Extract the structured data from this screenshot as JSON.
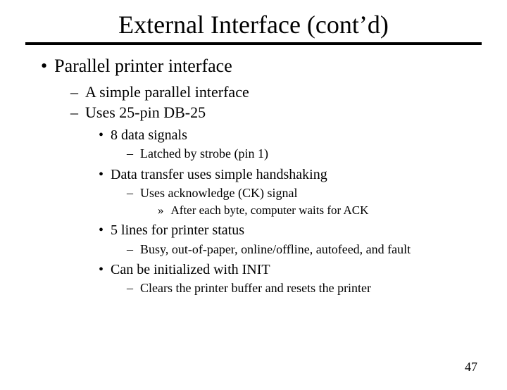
{
  "title": "External Interface (cont’d)",
  "page_number": "47",
  "bullets": {
    "b1": "Parallel printer interface",
    "b1_1": "A simple parallel interface",
    "b1_2": "Uses 25-pin DB-25",
    "b1_2_1": "8 data signals",
    "b1_2_1_1": "Latched by strobe (pin 1)",
    "b1_2_2": "Data transfer uses simple handshaking",
    "b1_2_2_1": "Uses acknowledge (CK) signal",
    "b1_2_2_1_1": "After each byte, computer waits for ACK",
    "b1_2_3": "5 lines for printer status",
    "b1_2_3_1": "Busy, out-of-paper, online/offline, autofeed, and fault",
    "b1_2_4": "Can be initialized with INIT",
    "b1_2_4_1": "Clears the printer buffer and resets the printer"
  }
}
